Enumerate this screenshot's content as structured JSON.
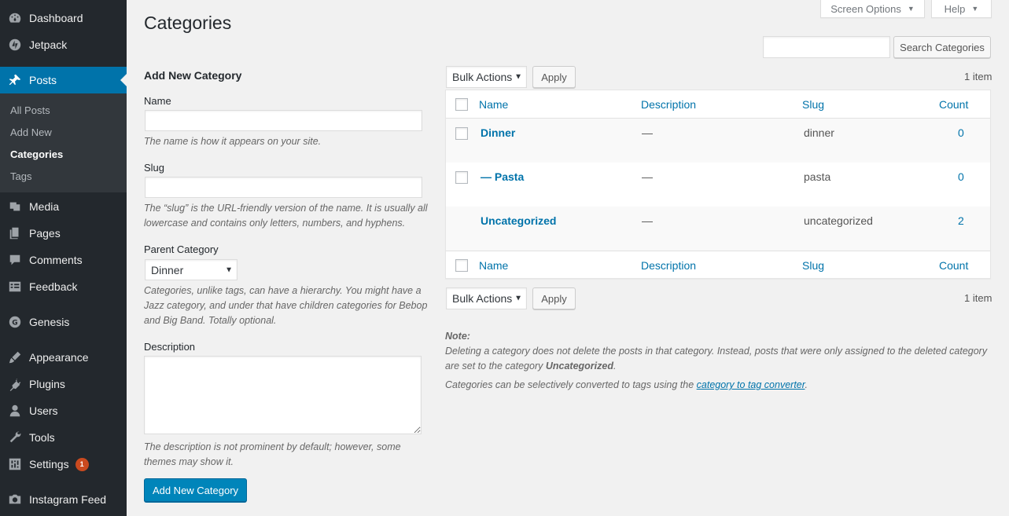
{
  "sidebar": {
    "items": [
      {
        "label": "Dashboard",
        "icon": "dashboard-icon"
      },
      {
        "label": "Jetpack",
        "icon": "jetpack-icon"
      },
      {
        "label": "Posts",
        "icon": "pushpin-icon"
      },
      {
        "label": "Media",
        "icon": "media-icon"
      },
      {
        "label": "Pages",
        "icon": "pages-icon"
      },
      {
        "label": "Comments",
        "icon": "comments-icon"
      },
      {
        "label": "Feedback",
        "icon": "feedback-icon"
      },
      {
        "label": "Genesis",
        "icon": "genesis-icon"
      },
      {
        "label": "Appearance",
        "icon": "appearance-icon"
      },
      {
        "label": "Plugins",
        "icon": "plugins-icon"
      },
      {
        "label": "Users",
        "icon": "users-icon"
      },
      {
        "label": "Tools",
        "icon": "tools-icon"
      },
      {
        "label": "Settings",
        "icon": "settings-icon",
        "badge": "1"
      },
      {
        "label": "Instagram Feed",
        "icon": "camera-icon"
      }
    ],
    "submenu": [
      "All Posts",
      "Add New",
      "Categories",
      "Tags"
    ]
  },
  "header": {
    "title": "Categories",
    "screen_options": "Screen Options",
    "help": "Help",
    "search_button": "Search Categories",
    "search_placeholder": ""
  },
  "form": {
    "heading": "Add New Category",
    "name_label": "Name",
    "name_value": "",
    "name_help": "The name is how it appears on your site.",
    "slug_label": "Slug",
    "slug_value": "",
    "slug_help": "The “slug” is the URL-friendly version of the name. It is usually all lowercase and contains only letters, numbers, and hyphens.",
    "parent_label": "Parent Category",
    "parent_value": "Dinner",
    "parent_help": "Categories, unlike tags, can have a hierarchy. You might have a Jazz category, and under that have children categories for Bebop and Big Band. Totally optional.",
    "description_label": "Description",
    "description_value": "",
    "description_help": "The description is not prominent by default; however, some themes may show it.",
    "submit": "Add New Category"
  },
  "table": {
    "bulk_actions": "Bulk Actions",
    "apply": "Apply",
    "items_count": "1 item",
    "columns": [
      "Name",
      "Description",
      "Slug",
      "Count"
    ],
    "rows": [
      {
        "name": "Dinner",
        "description": "—",
        "slug": "dinner",
        "count": "0",
        "checkbox": true
      },
      {
        "name": "— Pasta",
        "description": "—",
        "slug": "pasta",
        "count": "0",
        "checkbox": true
      },
      {
        "name": "Uncategorized",
        "description": "—",
        "slug": "uncategorized",
        "count": "2",
        "checkbox": false
      }
    ]
  },
  "note": {
    "title": "Note:",
    "line1a": "Deleting a category does not delete the posts in that category. Instead, posts that were only assigned to the deleted category are set to the category ",
    "line1b": "Uncategorized",
    "line1c": ".",
    "line2a": "Categories can be selectively converted to tags using the ",
    "link": "category to tag converter",
    "line2c": "."
  },
  "colors": {
    "sidebar_bg": "#23282d",
    "submenu_bg": "#32373c",
    "accent": "#0073aa",
    "primary_button": "#0085ba",
    "badge": "#ca4a1f"
  }
}
